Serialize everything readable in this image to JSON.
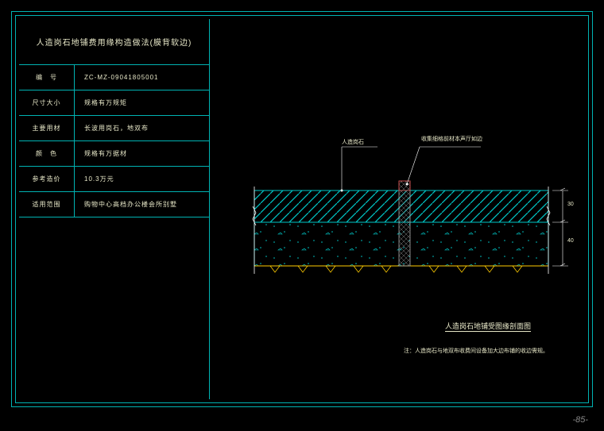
{
  "title": "人造岗石地铺费用缘构造做法(膜背软边)",
  "rows": [
    {
      "label": "编　号",
      "value": "ZC-MZ-09041805001"
    },
    {
      "label": "尺寸大小",
      "value": "规格有万规矩"
    },
    {
      "label": "主要用材",
      "value": "长波用岗石，地双布"
    },
    {
      "label": "颜　色",
      "value": "规格有万据材"
    },
    {
      "label": "参考造价",
      "value": "10.3万元"
    },
    {
      "label": "适用范围",
      "value": "购物中心高档办公楼会所别墅"
    }
  ],
  "labels": {
    "leader1": "人造岗石",
    "leader2": "收集细格前材本声厅如边",
    "dim1": "30",
    "dim2": "40"
  },
  "drawing_title": "人造岗石地铺受图缘剖面图",
  "note": "注：人造岗石与地双布收费间设备加大边布铺的收边需规。",
  "pagenum": "-85-"
}
